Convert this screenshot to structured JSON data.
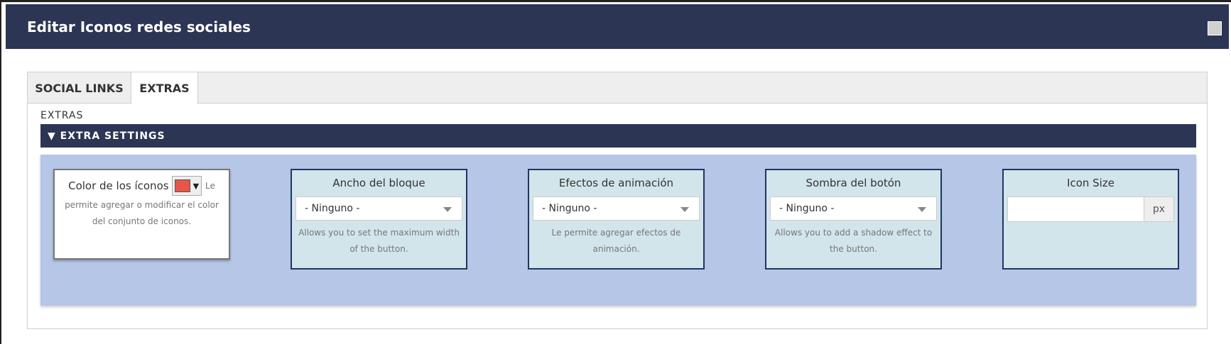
{
  "modal": {
    "title": "Editar Iconos redes sociales"
  },
  "tabs": [
    {
      "label": "SOCIAL LINKS"
    },
    {
      "label": "EXTRAS"
    }
  ],
  "section": {
    "label": "EXTRAS",
    "header": "▼ EXTRA SETTINGS"
  },
  "color_field": {
    "label": "Color de los íconos",
    "color": "#e8564a",
    "desc_lead": "Le",
    "desc": "permite agregar o modificar el color del conjunto de iconos."
  },
  "block_width": {
    "label": "Ancho del bloque",
    "value": "- Ninguno -",
    "desc": "Allows you to set the maximum width of the button."
  },
  "animation": {
    "label": "Efectos de animación",
    "value": "- Ninguno -",
    "desc": "Le permite agregar efectos de animación."
  },
  "shadow": {
    "label": "Sombra del botón",
    "value": "- Ninguno -",
    "desc": "Allows you to add a shadow effect to the button."
  },
  "icon_size": {
    "label": "Icon Size",
    "value": "",
    "unit": "px"
  },
  "colors": {
    "header_bg": "#2c3553",
    "settings_bg": "#b5c6e6",
    "card_bg": "#d2e5ea",
    "card_border": "#1f3566"
  }
}
